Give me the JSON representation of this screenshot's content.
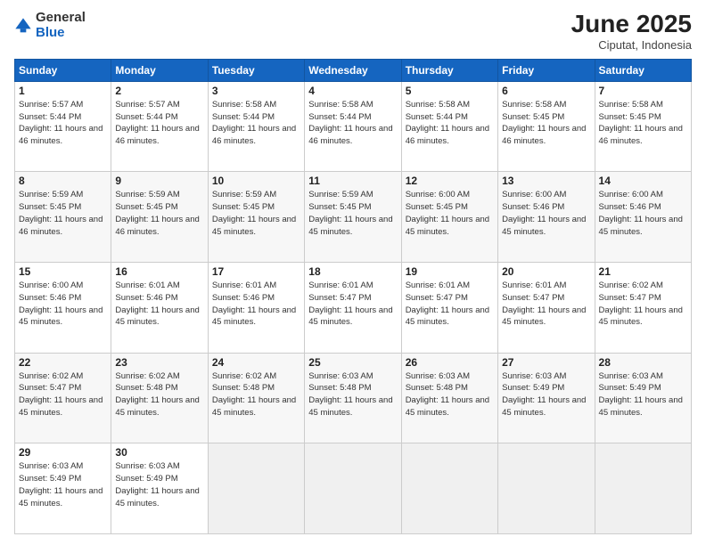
{
  "logo": {
    "general": "General",
    "blue": "Blue"
  },
  "title": "June 2025",
  "location": "Ciputat, Indonesia",
  "days_header": [
    "Sunday",
    "Monday",
    "Tuesday",
    "Wednesday",
    "Thursday",
    "Friday",
    "Saturday"
  ],
  "weeks": [
    [
      {
        "day": "1",
        "sunrise": "5:57 AM",
        "sunset": "5:44 PM",
        "daylight": "11 hours and 46 minutes."
      },
      {
        "day": "2",
        "sunrise": "5:57 AM",
        "sunset": "5:44 PM",
        "daylight": "11 hours and 46 minutes."
      },
      {
        "day": "3",
        "sunrise": "5:58 AM",
        "sunset": "5:44 PM",
        "daylight": "11 hours and 46 minutes."
      },
      {
        "day": "4",
        "sunrise": "5:58 AM",
        "sunset": "5:44 PM",
        "daylight": "11 hours and 46 minutes."
      },
      {
        "day": "5",
        "sunrise": "5:58 AM",
        "sunset": "5:44 PM",
        "daylight": "11 hours and 46 minutes."
      },
      {
        "day": "6",
        "sunrise": "5:58 AM",
        "sunset": "5:45 PM",
        "daylight": "11 hours and 46 minutes."
      },
      {
        "day": "7",
        "sunrise": "5:58 AM",
        "sunset": "5:45 PM",
        "daylight": "11 hours and 46 minutes."
      }
    ],
    [
      {
        "day": "8",
        "sunrise": "5:59 AM",
        "sunset": "5:45 PM",
        "daylight": "11 hours and 46 minutes."
      },
      {
        "day": "9",
        "sunrise": "5:59 AM",
        "sunset": "5:45 PM",
        "daylight": "11 hours and 46 minutes."
      },
      {
        "day": "10",
        "sunrise": "5:59 AM",
        "sunset": "5:45 PM",
        "daylight": "11 hours and 45 minutes."
      },
      {
        "day": "11",
        "sunrise": "5:59 AM",
        "sunset": "5:45 PM",
        "daylight": "11 hours and 45 minutes."
      },
      {
        "day": "12",
        "sunrise": "6:00 AM",
        "sunset": "5:45 PM",
        "daylight": "11 hours and 45 minutes."
      },
      {
        "day": "13",
        "sunrise": "6:00 AM",
        "sunset": "5:46 PM",
        "daylight": "11 hours and 45 minutes."
      },
      {
        "day": "14",
        "sunrise": "6:00 AM",
        "sunset": "5:46 PM",
        "daylight": "11 hours and 45 minutes."
      }
    ],
    [
      {
        "day": "15",
        "sunrise": "6:00 AM",
        "sunset": "5:46 PM",
        "daylight": "11 hours and 45 minutes."
      },
      {
        "day": "16",
        "sunrise": "6:01 AM",
        "sunset": "5:46 PM",
        "daylight": "11 hours and 45 minutes."
      },
      {
        "day": "17",
        "sunrise": "6:01 AM",
        "sunset": "5:46 PM",
        "daylight": "11 hours and 45 minutes."
      },
      {
        "day": "18",
        "sunrise": "6:01 AM",
        "sunset": "5:47 PM",
        "daylight": "11 hours and 45 minutes."
      },
      {
        "day": "19",
        "sunrise": "6:01 AM",
        "sunset": "5:47 PM",
        "daylight": "11 hours and 45 minutes."
      },
      {
        "day": "20",
        "sunrise": "6:01 AM",
        "sunset": "5:47 PM",
        "daylight": "11 hours and 45 minutes."
      },
      {
        "day": "21",
        "sunrise": "6:02 AM",
        "sunset": "5:47 PM",
        "daylight": "11 hours and 45 minutes."
      }
    ],
    [
      {
        "day": "22",
        "sunrise": "6:02 AM",
        "sunset": "5:47 PM",
        "daylight": "11 hours and 45 minutes."
      },
      {
        "day": "23",
        "sunrise": "6:02 AM",
        "sunset": "5:48 PM",
        "daylight": "11 hours and 45 minutes."
      },
      {
        "day": "24",
        "sunrise": "6:02 AM",
        "sunset": "5:48 PM",
        "daylight": "11 hours and 45 minutes."
      },
      {
        "day": "25",
        "sunrise": "6:03 AM",
        "sunset": "5:48 PM",
        "daylight": "11 hours and 45 minutes."
      },
      {
        "day": "26",
        "sunrise": "6:03 AM",
        "sunset": "5:48 PM",
        "daylight": "11 hours and 45 minutes."
      },
      {
        "day": "27",
        "sunrise": "6:03 AM",
        "sunset": "5:49 PM",
        "daylight": "11 hours and 45 minutes."
      },
      {
        "day": "28",
        "sunrise": "6:03 AM",
        "sunset": "5:49 PM",
        "daylight": "11 hours and 45 minutes."
      }
    ],
    [
      {
        "day": "29",
        "sunrise": "6:03 AM",
        "sunset": "5:49 PM",
        "daylight": "11 hours and 45 minutes."
      },
      {
        "day": "30",
        "sunrise": "6:03 AM",
        "sunset": "5:49 PM",
        "daylight": "11 hours and 45 minutes."
      },
      null,
      null,
      null,
      null,
      null
    ]
  ]
}
